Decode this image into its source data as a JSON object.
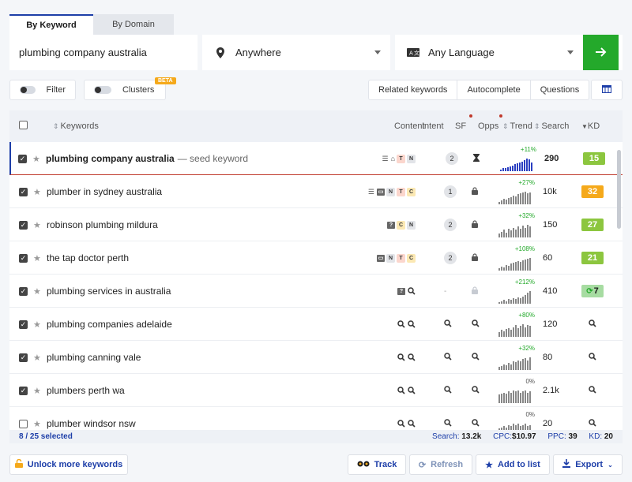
{
  "tabs": [
    {
      "label": "By Keyword",
      "active": true
    },
    {
      "label": "By Domain",
      "active": false
    }
  ],
  "search": {
    "value": "plumbing company australia",
    "placeholder": ""
  },
  "location": {
    "value": "Anywhere",
    "icon": "location-pin-icon"
  },
  "language": {
    "value": "Any Language",
    "icon": "translate-icon"
  },
  "go_button": {
    "icon": "arrow-right-icon",
    "color": "#24a92b"
  },
  "toggles": {
    "filter_label": "Filter",
    "clusters_label": "Clusters",
    "beta_label": "BETA"
  },
  "tool_buttons": {
    "related": "Related keywords",
    "autocomplete": "Autocomplete",
    "questions": "Questions"
  },
  "columns": {
    "keywords": "Keywords",
    "content": "Content",
    "intent": "Intent",
    "sf": "SF",
    "opps": "Opps",
    "trend": "Trend",
    "search": "Search",
    "kd": "KD"
  },
  "rows": [
    {
      "keyword": "plumbing company australia",
      "tag": "— seed keyword",
      "checked": true,
      "content": [
        "list",
        "home"
      ],
      "intent": [
        "T",
        "N"
      ],
      "sf": "2",
      "opps": "hourglass",
      "trend_pct": "+11%",
      "trend": [
        2,
        3,
        3,
        4,
        5,
        6,
        7,
        8,
        9,
        10,
        11,
        13,
        12,
        9
      ],
      "search": "290",
      "kd": "15",
      "kd_color": "#8cc63f",
      "seed": true
    },
    {
      "keyword": "plumber in sydney australia",
      "checked": true,
      "content": [
        "list",
        "box"
      ],
      "intent": [
        "N",
        "T",
        "C"
      ],
      "sf": "1",
      "opps": "lock",
      "trend_pct": "+27%",
      "trend": [
        3,
        4,
        6,
        5,
        7,
        8,
        10,
        9,
        11,
        12,
        13,
        14,
        12,
        13
      ],
      "search": "10k",
      "kd": "32",
      "kd_color": "#f5a91b"
    },
    {
      "keyword": "robinson plumbing mildura",
      "checked": true,
      "content": [
        "question"
      ],
      "intent": [
        "C",
        "N"
      ],
      "sf": "2",
      "opps": "lock",
      "trend_pct": "+32%",
      "trend": [
        4,
        6,
        8,
        5,
        9,
        7,
        10,
        8,
        11,
        9,
        12,
        10,
        13,
        11
      ],
      "search": "150",
      "kd": "27",
      "kd_color": "#8cc63f"
    },
    {
      "keyword": "the tap doctor perth",
      "checked": true,
      "content": [
        "box"
      ],
      "intent": [
        "N",
        "T",
        "C"
      ],
      "sf": "2",
      "opps": "lock",
      "trend_pct": "+108%",
      "trend": [
        3,
        5,
        4,
        7,
        6,
        8,
        9,
        10,
        11,
        10,
        12,
        13,
        14,
        15
      ],
      "search": "60",
      "kd": "21",
      "kd_color": "#8cc63f"
    },
    {
      "keyword": "plumbing services in australia",
      "checked": true,
      "content": [
        "question",
        "search"
      ],
      "intent": [],
      "sf": "-",
      "opps": "lock-faded",
      "trend_pct": "+212%",
      "trend": [
        2,
        3,
        4,
        3,
        5,
        4,
        6,
        5,
        7,
        6,
        8,
        10,
        12,
        14
      ],
      "search": "410",
      "kd": "7",
      "kd_color": "#a7dca2",
      "kd_refresh": true
    },
    {
      "keyword": "plumbing companies adelaide",
      "checked": true,
      "content": [
        "search",
        "search"
      ],
      "intent": [],
      "sf": "search",
      "opps": "search",
      "trend_pct": "+80%",
      "trend": [
        5,
        7,
        6,
        8,
        9,
        7,
        10,
        12,
        9,
        11,
        13,
        10,
        12,
        11
      ],
      "search": "120",
      "kd": "search"
    },
    {
      "keyword": "plumbing canning vale",
      "checked": true,
      "content": [
        "search",
        "search"
      ],
      "intent": [],
      "sf": "search",
      "opps": "search",
      "trend_pct": "+32%",
      "trend": [
        3,
        4,
        6,
        5,
        7,
        6,
        9,
        8,
        10,
        9,
        11,
        12,
        10,
        13
      ],
      "search": "80",
      "kd": "search"
    },
    {
      "keyword": "plumbers perth wa",
      "checked": true,
      "content": [
        "search",
        "search"
      ],
      "intent": [],
      "sf": "search",
      "opps": "search",
      "trend_pct": "0%",
      "trend": [
        8,
        9,
        10,
        9,
        11,
        10,
        12,
        11,
        12,
        10,
        11,
        12,
        10,
        11
      ],
      "search": "2.1k",
      "kd": "search"
    },
    {
      "keyword": "plumber windsor nsw",
      "checked": false,
      "content": [
        "search",
        "search"
      ],
      "intent": [],
      "sf": "search",
      "opps": "search",
      "trend_pct": "0%",
      "trend": [
        6,
        7,
        8,
        7,
        9,
        8,
        10,
        9,
        10,
        8,
        9,
        10,
        8,
        9
      ],
      "search": "20",
      "kd": "search"
    }
  ],
  "footer": {
    "selected": "8 / 25 selected",
    "search_label": "Search:",
    "search_value": "13.2k",
    "cpc_label": "CPC:",
    "cpc_value": "$10.97",
    "ppc_label": "PPC:",
    "ppc_value": "39",
    "kd_label": "KD:",
    "kd_value": "20"
  },
  "actions": {
    "unlock": "Unlock more keywords",
    "track": "Track",
    "refresh": "Refresh",
    "add_to_list": "Add to list",
    "export": "Export"
  }
}
